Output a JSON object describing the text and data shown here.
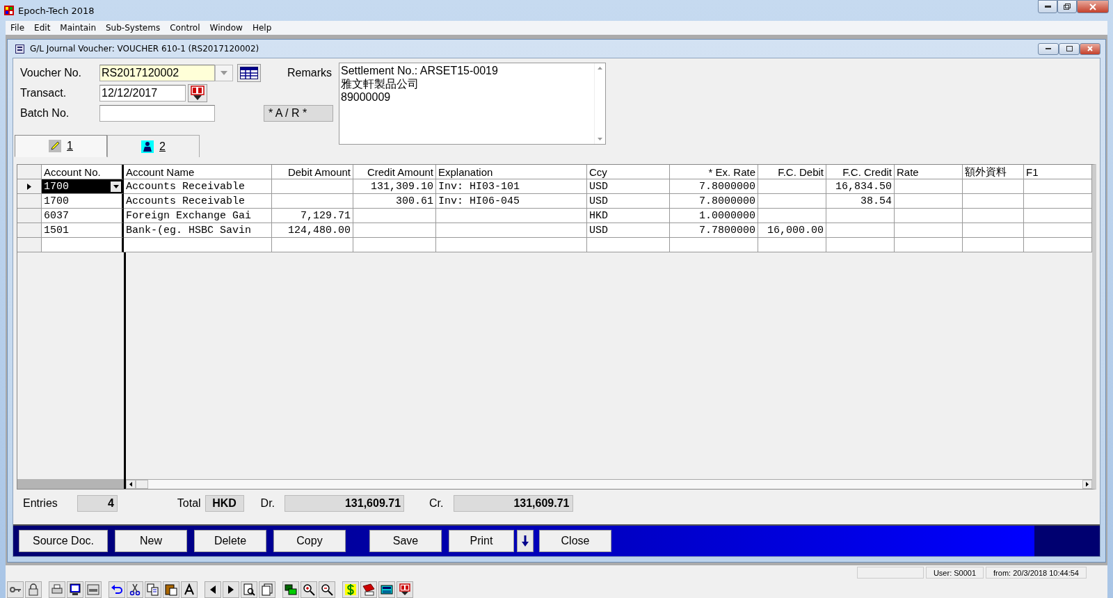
{
  "app_window": {
    "title": "Epoch-Tech 2018"
  },
  "menu": [
    {
      "label": "File"
    },
    {
      "label": "Edit"
    },
    {
      "label": "Maintain"
    },
    {
      "label": "Sub-Systems"
    },
    {
      "label": "Control"
    },
    {
      "label": "Window"
    },
    {
      "label": "Help"
    }
  ],
  "document_window": {
    "title": "G/L Journal Voucher: VOUCHER 610-1 (RS2017120002)"
  },
  "form": {
    "voucher_no": {
      "label": "Voucher No.",
      "value": "RS2017120002"
    },
    "transact_date": {
      "label": "Transact.",
      "value": "12/12/2017"
    },
    "batch_no": {
      "label": "Batch No."
    },
    "type_badge": "* A / R *",
    "remarks": {
      "label": "Remarks",
      "lines": [
        "Settlement No.: ARSET15-0019",
        "雅文軒製品公司",
        "89000009"
      ]
    }
  },
  "tabs": [
    {
      "label": "1",
      "kind": "edit",
      "selected": true
    },
    {
      "label": "2",
      "kind": "person",
      "selected": false
    }
  ],
  "grid": {
    "columns": [
      {
        "label": "Account No."
      },
      {
        "label": "Account Name"
      },
      {
        "label": "Debit Amount"
      },
      {
        "label": "Credit Amount"
      },
      {
        "label": "Explanation"
      },
      {
        "label": "Ccy"
      },
      {
        "label": "* Ex. Rate"
      },
      {
        "label": "F.C. Debit"
      },
      {
        "label": "F.C. Credit"
      },
      {
        "label": "Rate"
      },
      {
        "label": "額外資料"
      },
      {
        "label": "F1"
      }
    ],
    "rows": [
      {
        "current": true,
        "cells": [
          "1700",
          "Accounts Receivable",
          "",
          "131,309.10",
          "Inv: HI03-101",
          "USD",
          "7.8000000",
          "",
          "16,834.50",
          "",
          "",
          ""
        ]
      },
      {
        "current": false,
        "cells": [
          "1700",
          "Accounts Receivable",
          "",
          "300.61",
          "Inv: HI06-045",
          "USD",
          "7.8000000",
          "",
          "38.54",
          "",
          "",
          ""
        ]
      },
      {
        "current": false,
        "cells": [
          "6037",
          "Foreign Exchange Gai",
          "7,129.71",
          "",
          "",
          "HKD",
          "1.0000000",
          "",
          "",
          "",
          "",
          ""
        ]
      },
      {
        "current": false,
        "cells": [
          "1501",
          "Bank-(eg. HSBC Savin",
          "124,480.00",
          "",
          "",
          "USD",
          "7.7800000",
          "16,000.00",
          "",
          "",
          "",
          ""
        ]
      }
    ]
  },
  "totals": {
    "entries_label": "Entries",
    "entries": "4",
    "total_label": "Total",
    "currency": "HKD",
    "debit_label": "Dr.",
    "debit": "131,609.71",
    "credit_label": "Cr.",
    "credit": "131,609.71"
  },
  "buttons": [
    {
      "label": "Source Doc.",
      "has_menu": false
    },
    {
      "label": "New",
      "has_menu": false
    },
    {
      "label": "Delete",
      "has_menu": false
    },
    {
      "label": "Copy",
      "has_menu": false
    },
    {
      "label": "Save",
      "has_menu": false
    },
    {
      "label": "Print",
      "has_menu": true
    },
    {
      "label": "Close",
      "has_menu": false
    }
  ],
  "status_bar": [
    "User: S0001",
    "from: 20/3/2018 10:44:54"
  ]
}
